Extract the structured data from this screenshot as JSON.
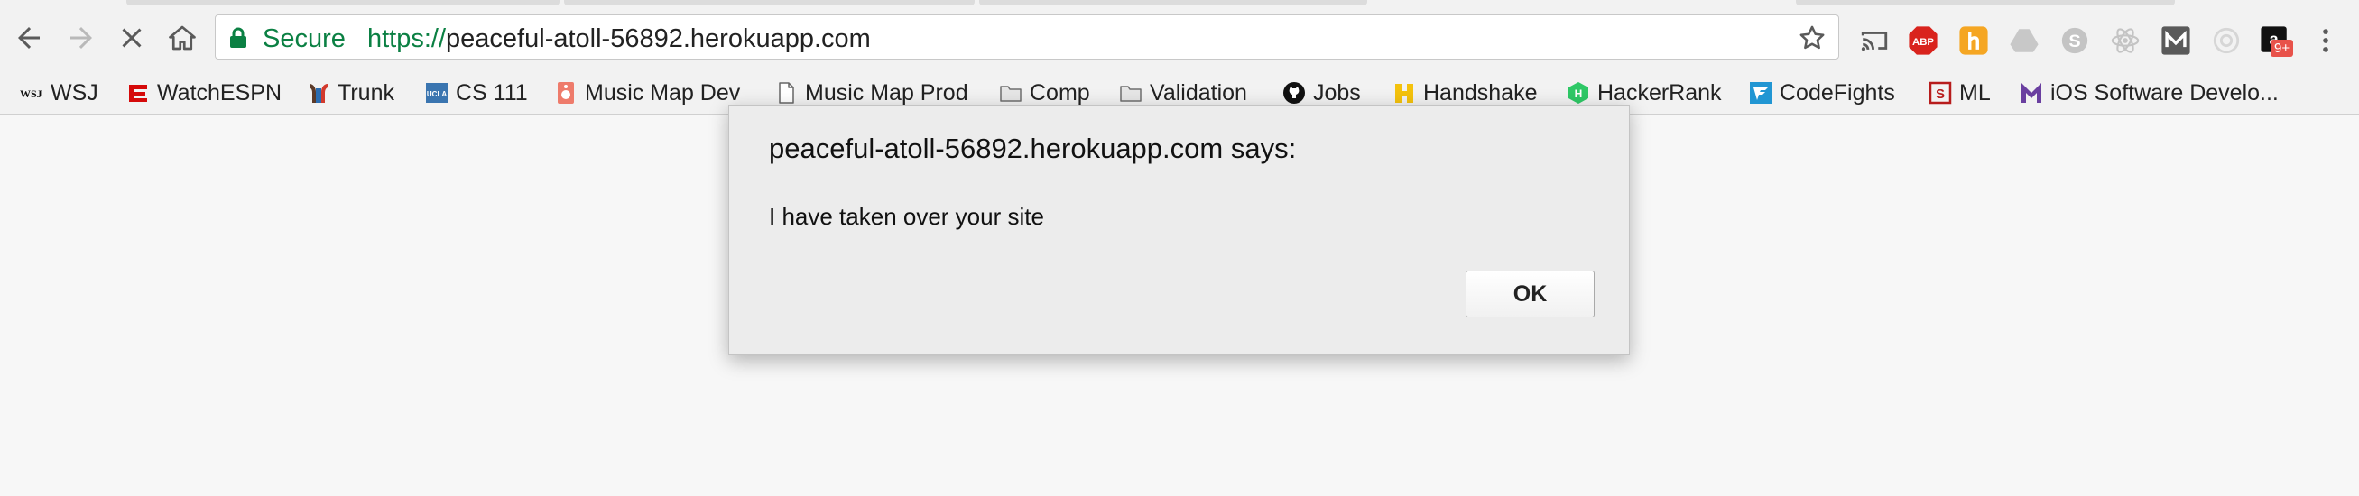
{
  "omnibox": {
    "secure_label": "Secure",
    "url_scheme": "https://",
    "url_host": "peaceful-atoll-56892.herokuapp.com"
  },
  "extensions": {
    "adblock_label": "ABP",
    "amazon_badge": "9+"
  },
  "bookmarks": [
    {
      "label": "WSJ",
      "icon": "wsj-icon"
    },
    {
      "label": "WatchESPN",
      "icon": "espn-icon"
    },
    {
      "label": "Trunk",
      "icon": "trunk-icon"
    },
    {
      "label": "CS 111",
      "icon": "ucla-icon"
    },
    {
      "label": "Music Map Dev",
      "icon": "music-map-icon"
    },
    {
      "label": "Music Map Prod",
      "icon": "page-icon"
    },
    {
      "label": "Comp",
      "icon": "folder-icon"
    },
    {
      "label": "Validation",
      "icon": "folder-icon"
    },
    {
      "label": "Jobs",
      "icon": "github-icon"
    },
    {
      "label": "Handshake",
      "icon": "handshake-icon"
    },
    {
      "label": "HackerRank",
      "icon": "hackerrank-icon"
    },
    {
      "label": "CodeFights",
      "icon": "codefights-icon"
    },
    {
      "label": "ML",
      "icon": "ml-icon"
    },
    {
      "label": "iOS Software Develo...",
      "icon": "ios-dev-icon"
    }
  ],
  "dialog": {
    "title": "peaceful-atoll-56892.herokuapp.com says:",
    "message": "I have taken over your site",
    "ok_label": "OK"
  },
  "colors": {
    "secure_green": "#0b8043",
    "espn_red": "#d50a0a",
    "hackerrank_green": "#2ec866"
  }
}
